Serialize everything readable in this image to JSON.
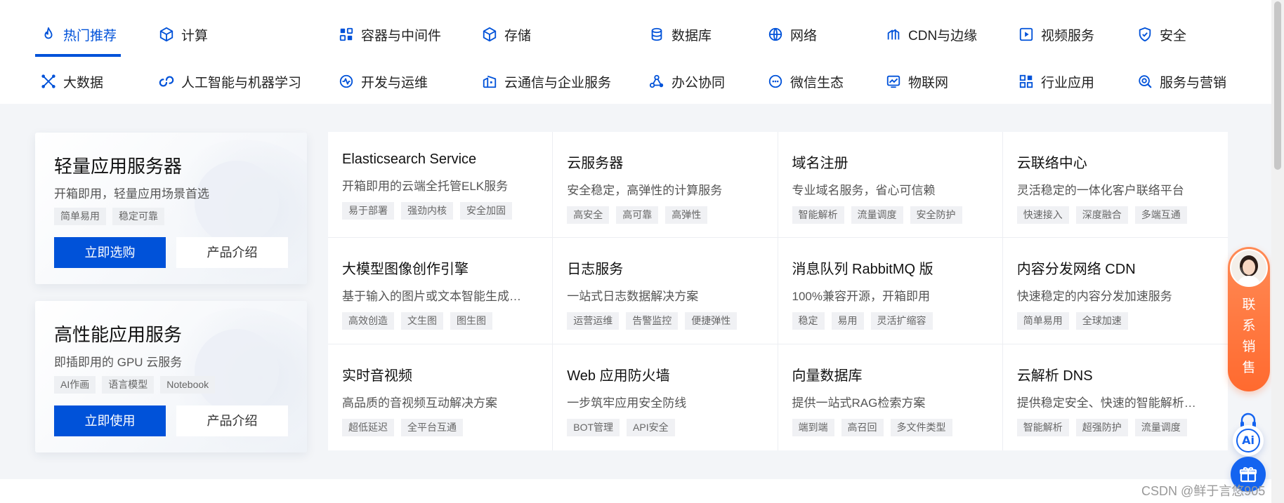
{
  "colors": {
    "brand": "#0052d9",
    "accent_orange": "#ff6a2f",
    "bg": "#f3f5f8"
  },
  "nav": {
    "row1": [
      {
        "label": "热门推荐",
        "icon": "flame-icon"
      },
      {
        "label": "计算",
        "icon": "cube-icon"
      },
      {
        "label": "容器与中间件",
        "icon": "container-icon"
      },
      {
        "label": "存储",
        "icon": "storage-box-icon"
      },
      {
        "label": "数据库",
        "icon": "database-icon"
      },
      {
        "label": "网络",
        "icon": "globe-icon"
      },
      {
        "label": "CDN与边缘",
        "icon": "cdn-icon"
      },
      {
        "label": "视频服务",
        "icon": "play-icon"
      },
      {
        "label": "安全",
        "icon": "shield-icon"
      }
    ],
    "row2": [
      {
        "label": "大数据",
        "icon": "big-data-icon"
      },
      {
        "label": "人工智能与机器学习",
        "icon": "ai-loop-icon"
      },
      {
        "label": "开发与运维",
        "icon": "pulse-icon"
      },
      {
        "label": "云通信与企业服务",
        "icon": "building-icon"
      },
      {
        "label": "办公协同",
        "icon": "collab-icon"
      },
      {
        "label": "微信生态",
        "icon": "chat-icon"
      },
      {
        "label": "物联网",
        "icon": "iot-icon"
      },
      {
        "label": "行业应用",
        "icon": "grid-apps-icon"
      },
      {
        "label": "服务与营销",
        "icon": "search-service-icon"
      }
    ]
  },
  "promos": [
    {
      "title": "轻量应用服务器",
      "subtitle": "开箱即用，轻量应用场景首选",
      "tags": [
        "简单易用",
        "稳定可靠"
      ],
      "primary": "立即选购",
      "secondary": "产品介绍"
    },
    {
      "title": "高性能应用服务",
      "subtitle": "即插即用的 GPU 云服务",
      "tags": [
        "AI作画",
        "语言模型",
        "Notebook"
      ],
      "primary": "立即使用",
      "secondary": "产品介绍"
    }
  ],
  "products": [
    {
      "title": "Elasticsearch Service",
      "desc": "开箱即用的云端全托管ELK服务",
      "tags": [
        "易于部署",
        "强劲内核",
        "安全加固"
      ]
    },
    {
      "title": "云服务器",
      "desc": "安全稳定，高弹性的计算服务",
      "tags": [
        "高安全",
        "高可靠",
        "高弹性"
      ]
    },
    {
      "title": "域名注册",
      "desc": "专业域名服务，省心可信赖",
      "tags": [
        "智能解析",
        "流量调度",
        "安全防护"
      ]
    },
    {
      "title": "云联络中心",
      "desc": "灵活稳定的一体化客户联络平台",
      "tags": [
        "快速接入",
        "深度融合",
        "多端互通"
      ]
    },
    {
      "title": "大模型图像创作引擎",
      "desc": "基于输入的图片或文本智能生成…",
      "tags": [
        "高效创造",
        "文生图",
        "图生图"
      ]
    },
    {
      "title": "日志服务",
      "desc": "一站式日志数据解决方案",
      "tags": [
        "运营运维",
        "告警监控",
        "便捷弹性"
      ]
    },
    {
      "title": "消息队列 RabbitMQ 版",
      "desc": "100%兼容开源，开箱即用",
      "tags": [
        "稳定",
        "易用",
        "灵活扩缩容"
      ]
    },
    {
      "title": "内容分发网络 CDN",
      "desc": "快速稳定的内容分发加速服务",
      "tags": [
        "简单易用",
        "全球加速"
      ]
    },
    {
      "title": "实时音视频",
      "desc": "高品质的音视频互动解决方案",
      "tags": [
        "超低延迟",
        "全平台互通"
      ]
    },
    {
      "title": "Web 应用防火墙",
      "desc": "一步筑牢应用安全防线",
      "tags": [
        "BOT管理",
        "API安全"
      ]
    },
    {
      "title": "向量数据库",
      "desc": "提供一站式RAG检索方案",
      "tags": [
        "端到端",
        "高召回",
        "多文件类型"
      ]
    },
    {
      "title": "云解析 DNS",
      "desc": "提供稳定安全、快速的智能解析…",
      "tags": [
        "智能解析",
        "超强防护",
        "流量调度"
      ]
    }
  ],
  "float": {
    "sales_label": "联系销售",
    "ai_label": "Ai"
  },
  "watermark": "CSDN @鲜于言悠905"
}
